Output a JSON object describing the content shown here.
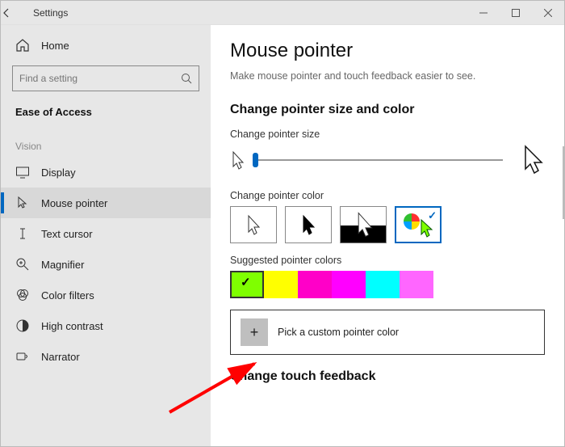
{
  "titlebar": {
    "title": "Settings"
  },
  "sidebar": {
    "home": "Home",
    "search_placeholder": "Find a setting",
    "category": "Ease of Access",
    "group": "Vision",
    "items": [
      {
        "label": "Display"
      },
      {
        "label": "Mouse pointer"
      },
      {
        "label": "Text cursor"
      },
      {
        "label": "Magnifier"
      },
      {
        "label": "Color filters"
      },
      {
        "label": "High contrast"
      },
      {
        "label": "Narrator"
      }
    ]
  },
  "main": {
    "title": "Mouse pointer",
    "description": "Make mouse pointer and touch feedback easier to see.",
    "section1": "Change pointer size and color",
    "size_label": "Change pointer size",
    "color_label": "Change pointer color",
    "suggested_label": "Suggested pointer colors",
    "custom_label": "Pick a custom pointer color",
    "section2": "Change touch feedback",
    "swatches": [
      "#7fff00",
      "#ffff00",
      "#ff00c8",
      "#ff00ff",
      "#00ffff",
      "#ff66ff"
    ]
  }
}
